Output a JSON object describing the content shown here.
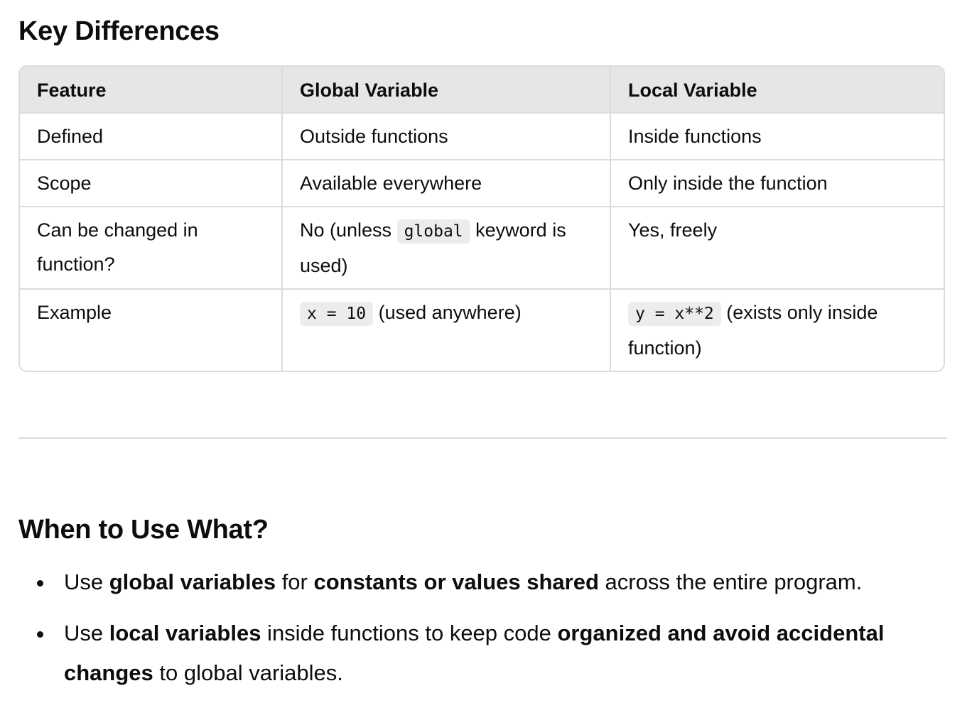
{
  "headings": {
    "key_differences": "Key Differences",
    "when_to_use": "When to Use What?"
  },
  "table": {
    "headers": [
      "Feature",
      "Global Variable",
      "Local Variable"
    ],
    "rows": [
      {
        "feature": "Defined",
        "global": "Outside functions",
        "local": "Inside functions"
      },
      {
        "feature": "Scope",
        "global": "Available everywhere",
        "local": "Only inside the function"
      },
      {
        "feature": "Can be changed in function?",
        "global_prefix": "No (unless ",
        "global_code": "global",
        "global_suffix": " keyword is used)",
        "local": "Yes, freely"
      },
      {
        "feature": "Example",
        "global_code": "x = 10",
        "global_suffix": " (used anywhere)",
        "local_code": "y = x**2",
        "local_suffix": " (exists only inside function)"
      }
    ]
  },
  "bullets": [
    {
      "t1": "Use ",
      "b1": "global variables",
      "t2": " for ",
      "b2": "constants or values shared",
      "t3": " across the entire program."
    },
    {
      "t1": "Use ",
      "b1": "local variables",
      "t2": " inside functions to keep code ",
      "b2": "organized and avoid accidental changes",
      "t3": " to global variables."
    }
  ]
}
